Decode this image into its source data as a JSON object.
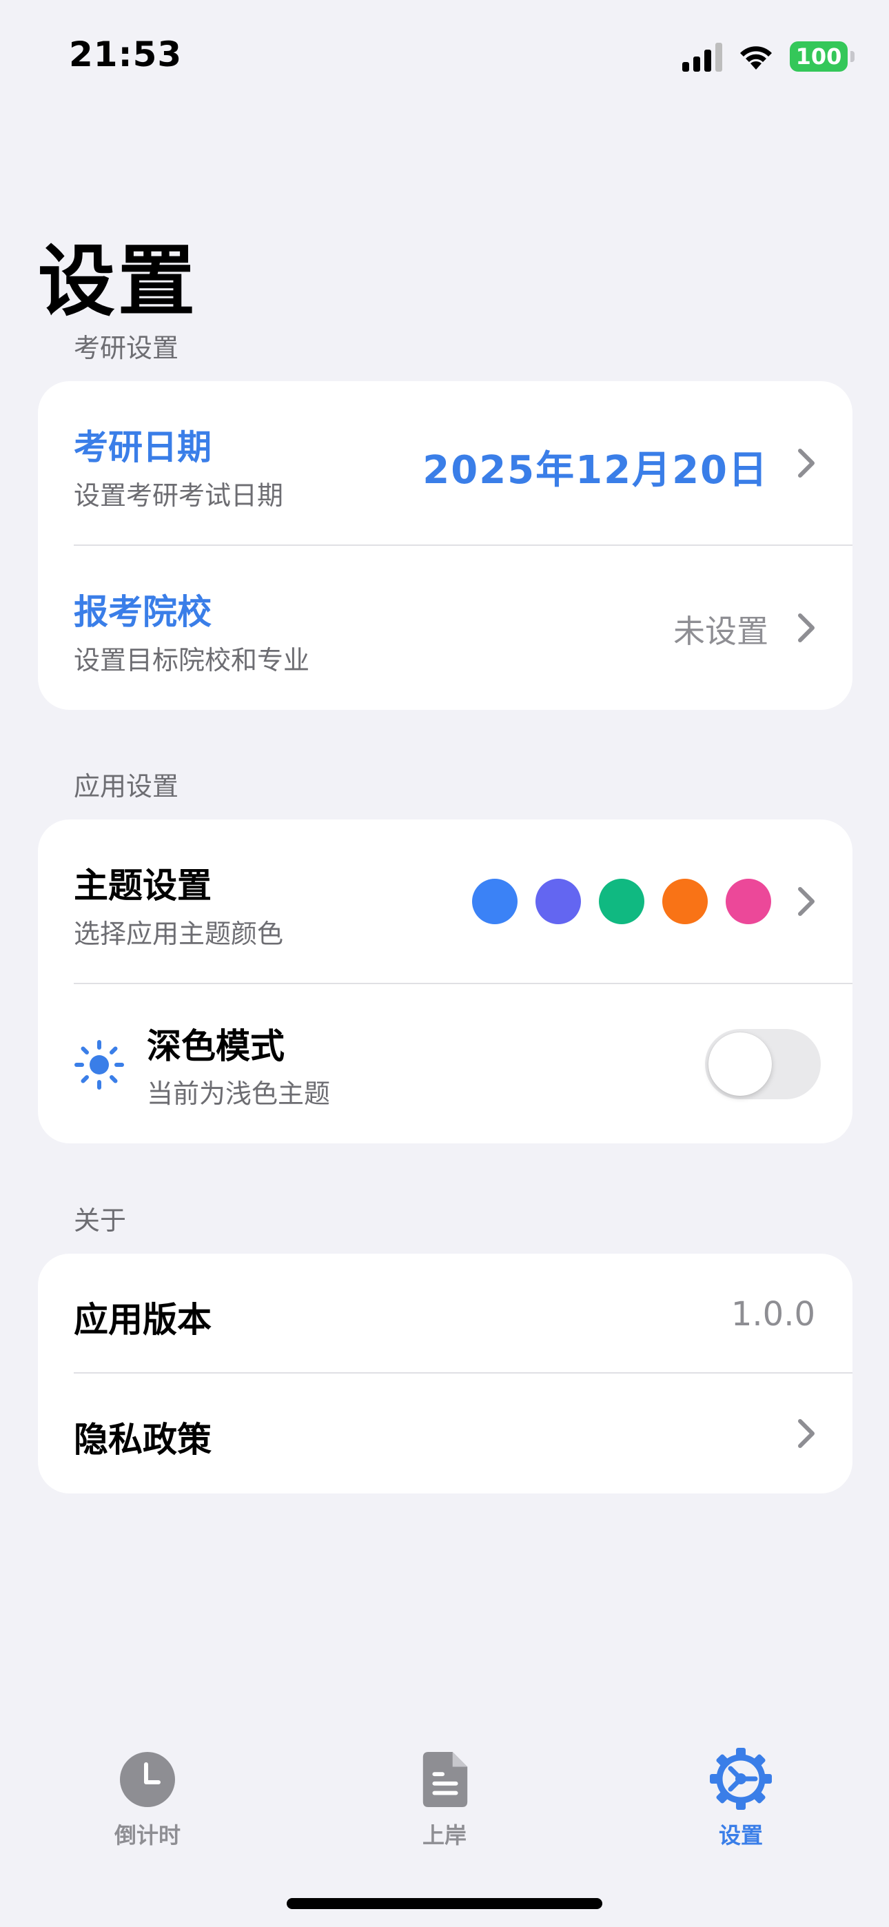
{
  "status_bar": {
    "time": "21:53",
    "battery": "100"
  },
  "page": {
    "title": "设置"
  },
  "sections": {
    "exam": {
      "header": "考研设置",
      "date": {
        "title": "考研日期",
        "subtitle": "设置考研考试日期",
        "value": "2025年12月20日"
      },
      "school": {
        "title": "报考院校",
        "subtitle": "设置目标院校和专业",
        "value": "未设置"
      }
    },
    "app": {
      "header": "应用设置",
      "theme": {
        "title": "主题设置",
        "subtitle": "选择应用主题颜色",
        "colors": [
          "#3b82f6",
          "#6366f1",
          "#10b981",
          "#f97316",
          "#ec4899"
        ]
      },
      "dark_mode": {
        "title": "深色模式",
        "subtitle": "当前为浅色主题",
        "enabled": false
      }
    },
    "about": {
      "header": "关于",
      "version": {
        "title": "应用版本",
        "value": "1.0.0"
      },
      "privacy": {
        "title": "隐私政策"
      }
    }
  },
  "tabs": [
    {
      "label": "倒计时",
      "icon": "clock-icon",
      "active": false
    },
    {
      "label": "上岸",
      "icon": "document-icon",
      "active": false
    },
    {
      "label": "设置",
      "icon": "gear-icon",
      "active": true
    }
  ],
  "colors": {
    "accent": "#3a7ee8",
    "inactive": "#8e8e93",
    "background": "#f2f2f7"
  }
}
